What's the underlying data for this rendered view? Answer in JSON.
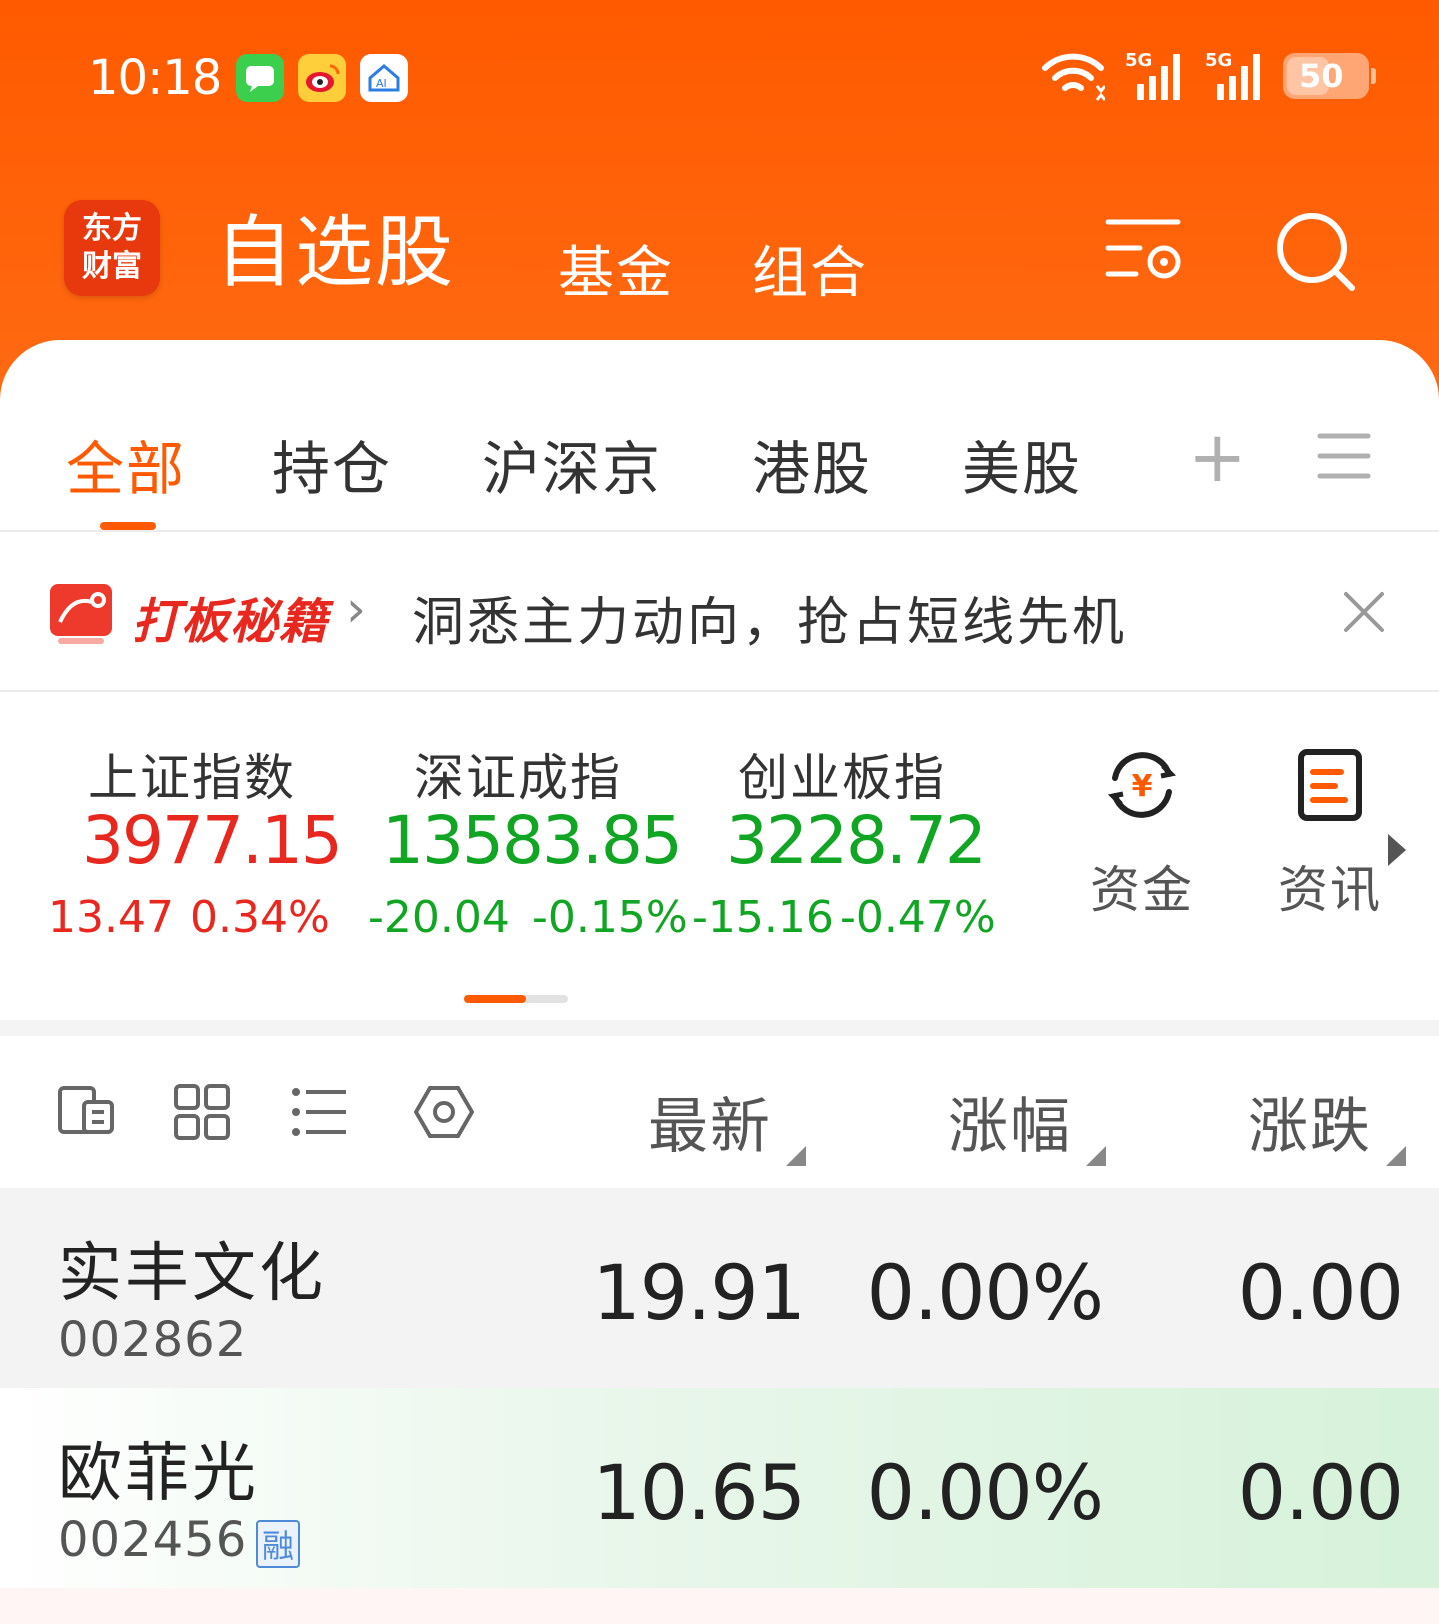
{
  "status_bar": {
    "time": "10:18",
    "signal1_label": "5G",
    "signal2_label": "5G",
    "battery": "50"
  },
  "header": {
    "logo_line1": "东方",
    "logo_line2": "财富",
    "title": "自选股",
    "tab_fund": "基金",
    "tab_portfolio": "组合"
  },
  "tabs": {
    "all": "全部",
    "holdings": "持仓",
    "hs": "沪深京",
    "hk": "港股",
    "us": "美股",
    "add": "+"
  },
  "banner": {
    "tag": "打板秘籍",
    "arrow": "›",
    "text": "洞悉主力动向，抢占短线先机"
  },
  "indices": [
    {
      "name": "上证指数",
      "value": "3977.15",
      "change": "13.47",
      "pct": "0.34%",
      "direction": "up"
    },
    {
      "name": "深证成指",
      "value": "13583.85",
      "change": "-20.04",
      "pct": "-0.15%",
      "direction": "down"
    },
    {
      "name": "创业板指",
      "value": "3228.72",
      "change": "-15.16",
      "pct": "-0.47%",
      "direction": "down"
    }
  ],
  "quick_links": {
    "funds": "资金",
    "news": "资讯"
  },
  "list_header": {
    "latest": "最新",
    "change_pct": "涨幅",
    "change": "涨跌"
  },
  "stocks": [
    {
      "name": "实丰文化",
      "code": "002862",
      "price": "19.91",
      "pct": "0.00%",
      "change": "0.00",
      "margin_tag": ""
    },
    {
      "name": "欧菲光",
      "code": "002456",
      "price": "10.65",
      "pct": "0.00%",
      "change": "0.00",
      "margin_tag": "融"
    }
  ],
  "colors": {
    "brand_orange": "#ff5a00",
    "up_red": "#e8281e",
    "down_green": "#10a522"
  }
}
